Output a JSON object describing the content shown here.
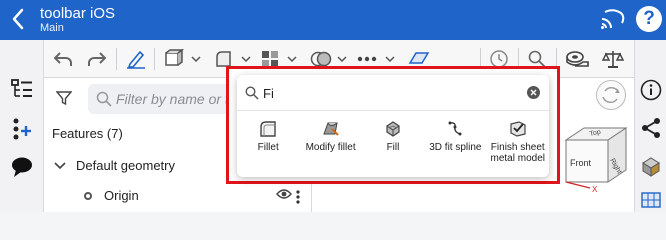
{
  "header": {
    "title": "toolbar iOS",
    "subtitle": "Main",
    "help_glyph": "?"
  },
  "toolbar": {
    "icons": [
      "undo-icon",
      "redo-icon",
      "sketch-pencil-icon",
      "extrude-icon",
      "fillet-tool-icon",
      "pattern-icon",
      "boolean-icon",
      "more-icon",
      "plane-icon",
      "clock-icon",
      "search-icon",
      "measure-icon",
      "mass-properties-icon"
    ]
  },
  "left_rail": {
    "icons": [
      "feature-list-icon",
      "add-part-icon",
      "comment-icon"
    ]
  },
  "right_rail": {
    "icons": [
      "info-icon",
      "share-icon",
      "parts-icon",
      "grid-icon"
    ]
  },
  "feature_panel": {
    "filter_placeholder": "Filter by name or ty",
    "features_heading": "Features (7)",
    "group_label": "Default geometry",
    "origin_label": "Origin"
  },
  "search_popup": {
    "query": "Fi",
    "results": [
      {
        "label": "Fillet",
        "icon": "fillet-icon"
      },
      {
        "label": "Modify fillet",
        "icon": "modify-fillet-icon"
      },
      {
        "label": "Fill",
        "icon": "fill-icon"
      },
      {
        "label": "3D fit spline",
        "icon": "fit-spline-icon"
      },
      {
        "label": "Finish sheet metal model",
        "icon": "finish-sheet-metal-icon"
      }
    ]
  },
  "view_cube": {
    "top": "Top",
    "front": "Front",
    "right": "Right",
    "axis_x": "X"
  },
  "colors": {
    "header_blue": "#1f64c8",
    "highlight_red": "#e0141b"
  }
}
